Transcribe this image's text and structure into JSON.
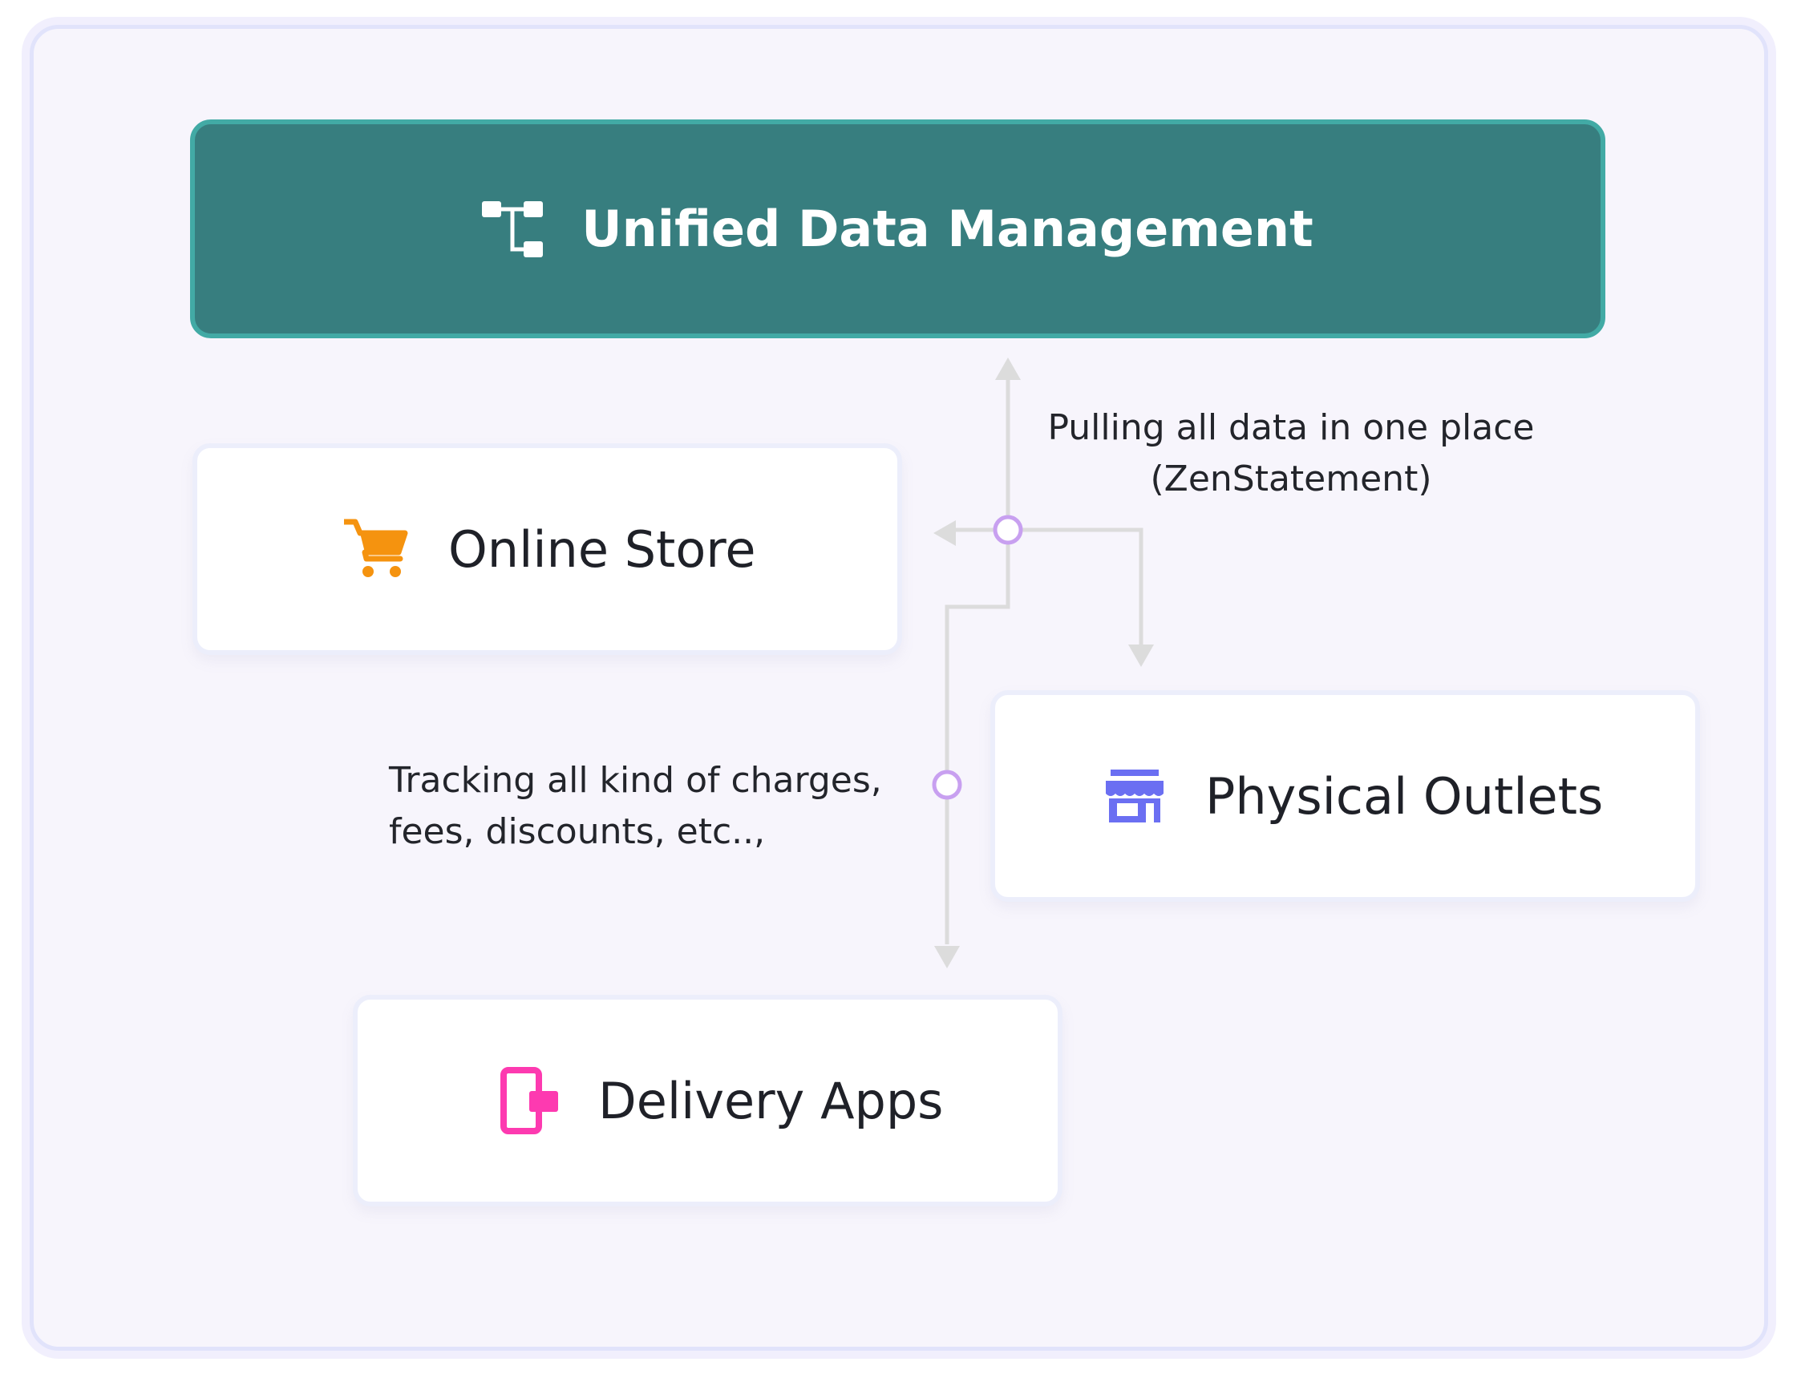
{
  "hub": {
    "title": "Unified Data Management",
    "icon": "hierarchy-icon",
    "background_color": "#377e7f",
    "border_color": "#42aaa5"
  },
  "nodes": [
    {
      "id": "online-store",
      "label": "Online Store",
      "icon": "shopping-cart-icon",
      "icon_color": "#f5930f"
    },
    {
      "id": "physical-outlets",
      "label": "Physical Outlets",
      "icon": "storefront-icon",
      "icon_color": "#6b6ff2"
    },
    {
      "id": "delivery-apps",
      "label": "Delivery Apps",
      "icon": "mobile-phone-icon",
      "icon_color": "#fd3ab0"
    }
  ],
  "annotations": {
    "pulling_line1": "Pulling all data in one place",
    "pulling_line2": "(ZenStatement)",
    "tracking_line1": "Tracking all kind of charges,",
    "tracking_line2": "fees, discounts, etc..,"
  },
  "colors": {
    "connector": "#dcdcdc",
    "junction": "#c8a0f0"
  }
}
